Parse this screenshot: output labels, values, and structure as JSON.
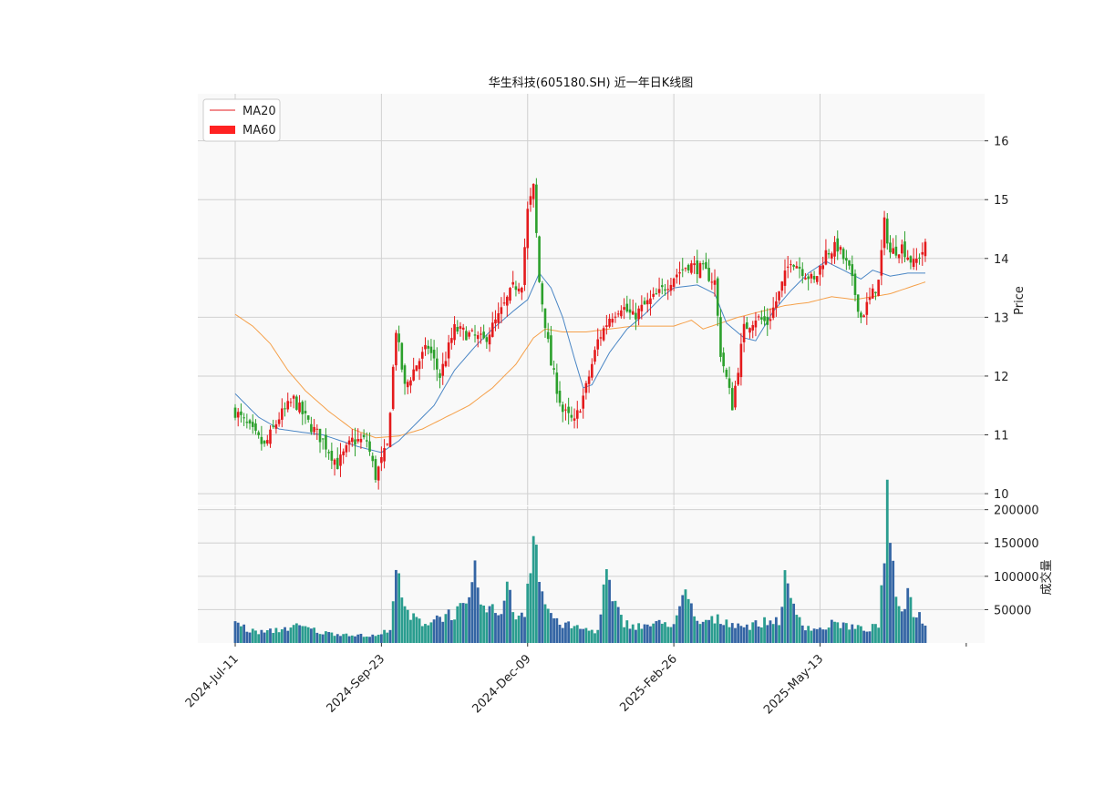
{
  "chart_data": {
    "type": "candlestick",
    "title": "华生科技(605180.SH) 近一年日K线图",
    "price_axis": {
      "label": "Price",
      "ticks": [
        10,
        11,
        12,
        13,
        14,
        15,
        16
      ],
      "ylim": [
        9.8,
        16.8
      ]
    },
    "volume_axis": {
      "label": "成交量",
      "ticks": [
        50000,
        100000,
        150000,
        200000
      ],
      "ylim": [
        0,
        205000
      ]
    },
    "x_ticks": [
      "2024-Jul-11",
      "2024-Sep-23",
      "2024-Dec-09",
      "2025-Feb-26",
      "2025-May-13"
    ],
    "x_tick_index": [
      0,
      50,
      100,
      150,
      200
    ],
    "x_total": 250,
    "legend": {
      "position": "top-left",
      "entries": [
        "MA20",
        "MA60"
      ]
    },
    "grid": true,
    "colors": {
      "up": "#e41a1c",
      "down": "#2ca02c",
      "ma20": "#4a86c5",
      "ma60": "#f5a04a",
      "vol_up": "#2a9d8f",
      "vol_down": "#3465a4",
      "ma20_legend": "#e41a1c",
      "ma60_legend": "#ff2222"
    },
    "close_anchors": [
      [
        0,
        11.4
      ],
      [
        5,
        11.1
      ],
      [
        10,
        10.8
      ],
      [
        15,
        11.3
      ],
      [
        20,
        11.6
      ],
      [
        25,
        11.2
      ],
      [
        30,
        10.9
      ],
      [
        35,
        10.5
      ],
      [
        40,
        10.9
      ],
      [
        45,
        10.9
      ],
      [
        48,
        10.3
      ],
      [
        52,
        10.8
      ],
      [
        55,
        12.8
      ],
      [
        58,
        11.8
      ],
      [
        62,
        12.2
      ],
      [
        66,
        12.5
      ],
      [
        70,
        12.0
      ],
      [
        75,
        12.8
      ],
      [
        80,
        12.7
      ],
      [
        85,
        12.6
      ],
      [
        90,
        13.0
      ],
      [
        95,
        13.5
      ],
      [
        98,
        13.6
      ],
      [
        100,
        14.8
      ],
      [
        102,
        15.2
      ],
      [
        104,
        13.6
      ],
      [
        108,
        12.2
      ],
      [
        112,
        11.4
      ],
      [
        116,
        11.2
      ],
      [
        120,
        11.8
      ],
      [
        124,
        12.6
      ],
      [
        128,
        13.0
      ],
      [
        132,
        13.2
      ],
      [
        136,
        13.0
      ],
      [
        140,
        13.2
      ],
      [
        145,
        13.4
      ],
      [
        150,
        13.7
      ],
      [
        155,
        13.9
      ],
      [
        160,
        13.8
      ],
      [
        164,
        13.6
      ],
      [
        166,
        12.4
      ],
      [
        170,
        11.5
      ],
      [
        174,
        12.8
      ],
      [
        178,
        13.0
      ],
      [
        182,
        12.9
      ],
      [
        186,
        13.4
      ],
      [
        190,
        14.0
      ],
      [
        194,
        13.8
      ],
      [
        198,
        13.6
      ],
      [
        202,
        14.1
      ],
      [
        206,
        14.2
      ],
      [
        210,
        13.8
      ],
      [
        214,
        13.0
      ],
      [
        218,
        13.4
      ],
      [
        220,
        13.6
      ],
      [
        222,
        14.6
      ],
      [
        224,
        14.1
      ],
      [
        228,
        14.2
      ],
      [
        232,
        13.9
      ],
      [
        236,
        14.2
      ]
    ],
    "ma20_anchors": [
      [
        0,
        11.7
      ],
      [
        8,
        11.3
      ],
      [
        15,
        11.1
      ],
      [
        22,
        11.05
      ],
      [
        30,
        11.0
      ],
      [
        36,
        10.9
      ],
      [
        42,
        10.8
      ],
      [
        50,
        10.7
      ],
      [
        56,
        10.9
      ],
      [
        62,
        11.2
      ],
      [
        68,
        11.5
      ],
      [
        75,
        12.1
      ],
      [
        82,
        12.5
      ],
      [
        88,
        12.8
      ],
      [
        95,
        13.1
      ],
      [
        100,
        13.3
      ],
      [
        104,
        13.75
      ],
      [
        108,
        13.5
      ],
      [
        112,
        13.0
      ],
      [
        116,
        12.3
      ],
      [
        119,
        11.8
      ],
      [
        122,
        11.85
      ],
      [
        128,
        12.4
      ],
      [
        134,
        12.8
      ],
      [
        140,
        13.05
      ],
      [
        146,
        13.35
      ],
      [
        150,
        13.5
      ],
      [
        158,
        13.55
      ],
      [
        164,
        13.4
      ],
      [
        168,
        12.9
      ],
      [
        174,
        12.65
      ],
      [
        178,
        12.6
      ],
      [
        184,
        13.1
      ],
      [
        190,
        13.45
      ],
      [
        196,
        13.75
      ],
      [
        202,
        13.95
      ],
      [
        208,
        13.8
      ],
      [
        214,
        13.65
      ],
      [
        218,
        13.8
      ],
      [
        224,
        13.7
      ],
      [
        230,
        13.75
      ],
      [
        236,
        13.75
      ]
    ],
    "ma60_anchors": [
      [
        0,
        13.05
      ],
      [
        6,
        12.85
      ],
      [
        12,
        12.55
      ],
      [
        18,
        12.1
      ],
      [
        24,
        11.75
      ],
      [
        32,
        11.4
      ],
      [
        40,
        11.1
      ],
      [
        48,
        10.95
      ],
      [
        56,
        10.98
      ],
      [
        64,
        11.1
      ],
      [
        72,
        11.3
      ],
      [
        80,
        11.5
      ],
      [
        88,
        11.8
      ],
      [
        96,
        12.2
      ],
      [
        102,
        12.65
      ],
      [
        106,
        12.8
      ],
      [
        112,
        12.75
      ],
      [
        120,
        12.75
      ],
      [
        128,
        12.8
      ],
      [
        136,
        12.85
      ],
      [
        144,
        12.85
      ],
      [
        150,
        12.85
      ],
      [
        156,
        12.95
      ],
      [
        160,
        12.8
      ],
      [
        166,
        12.9
      ],
      [
        172,
        13.0
      ],
      [
        180,
        13.1
      ],
      [
        188,
        13.2
      ],
      [
        196,
        13.25
      ],
      [
        204,
        13.35
      ],
      [
        212,
        13.3
      ],
      [
        218,
        13.35
      ],
      [
        224,
        13.4
      ],
      [
        230,
        13.5
      ],
      [
        236,
        13.6
      ]
    ],
    "volume_anchors": [
      [
        0,
        32000
      ],
      [
        5,
        18000
      ],
      [
        10,
        16000
      ],
      [
        15,
        20000
      ],
      [
        20,
        25000
      ],
      [
        25,
        22000
      ],
      [
        30,
        15000
      ],
      [
        35,
        14000
      ],
      [
        40,
        13000
      ],
      [
        45,
        10000
      ],
      [
        50,
        12000
      ],
      [
        53,
        25000
      ],
      [
        55,
        110000
      ],
      [
        57,
        60000
      ],
      [
        60,
        38000
      ],
      [
        65,
        30000
      ],
      [
        70,
        40000
      ],
      [
        75,
        45000
      ],
      [
        80,
        55000
      ],
      [
        82,
        100000
      ],
      [
        85,
        50000
      ],
      [
        90,
        45000
      ],
      [
        93,
        80000
      ],
      [
        96,
        40000
      ],
      [
        99,
        48000
      ],
      [
        101,
        130000
      ],
      [
        102,
        195000
      ],
      [
        103,
        155000
      ],
      [
        104,
        90000
      ],
      [
        106,
        60000
      ],
      [
        110,
        30000
      ],
      [
        115,
        25000
      ],
      [
        120,
        20000
      ],
      [
        124,
        18000
      ],
      [
        127,
        105000
      ],
      [
        129,
        60000
      ],
      [
        133,
        30000
      ],
      [
        138,
        25000
      ],
      [
        143,
        28000
      ],
      [
        150,
        30000
      ],
      [
        154,
        70000
      ],
      [
        158,
        30000
      ],
      [
        165,
        35000
      ],
      [
        170,
        30000
      ],
      [
        175,
        25000
      ],
      [
        180,
        30000
      ],
      [
        186,
        35000
      ],
      [
        188,
        90000
      ],
      [
        190,
        60000
      ],
      [
        195,
        25000
      ],
      [
        200,
        20000
      ],
      [
        205,
        30000
      ],
      [
        210,
        25000
      ],
      [
        215,
        20000
      ],
      [
        220,
        25000
      ],
      [
        223,
        198000
      ],
      [
        224,
        130000
      ],
      [
        226,
        70000
      ],
      [
        228,
        55000
      ],
      [
        230,
        75000
      ],
      [
        232,
        50000
      ],
      [
        236,
        30000
      ]
    ]
  }
}
